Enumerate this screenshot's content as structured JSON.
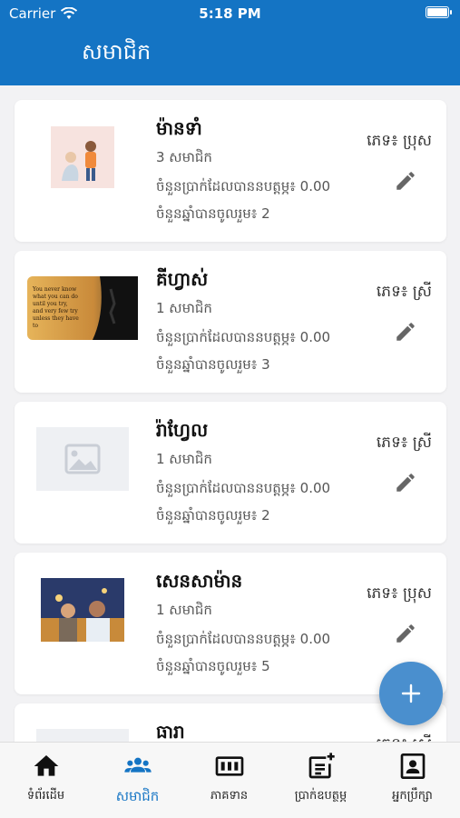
{
  "status_bar": {
    "carrier": "Carrier",
    "time": "5:18 PM"
  },
  "header": {
    "title": "សមាជិក"
  },
  "members": [
    {
      "name": "ម៉ានទាំ",
      "count": "3 សមាជិក",
      "amount": "ចំនួនប្រាក់ដែលបាននបត្តម្ភ៖ 0.00",
      "years": "ចំនួនឆ្នាំបានចូលរួម៖ 2",
      "gender": "ភេទ៖ ប្រុស"
    },
    {
      "name": "គីហ្វាស់",
      "count": "1 សមាជិក",
      "amount": "ចំនួនប្រាក់ដែលបាននបត្តម្ភ៖ 0.00",
      "years": "ចំនួនឆ្នាំបានចូលរួម៖ 3",
      "gender": "ភេទ៖ ស្រី"
    },
    {
      "name": "រ៉ាហ្វែល",
      "count": "1 សមាជិក",
      "amount": "ចំនួនប្រាក់ដែលបាននបត្តម្ភ៖ 0.00",
      "years": "ចំនួនឆ្នាំបានចូលរួម៖ 2",
      "gender": "ភេទ៖ ស្រី"
    },
    {
      "name": "សេនសាម៉ាន",
      "count": "1 សមាជិក",
      "amount": "ចំនួនប្រាក់ដែលបាននបត្តម្ភ៖ 0.00",
      "years": "ចំនួនឆ្នាំបានចូលរួម៖ 5",
      "gender": "ភេទ៖ ប្រុស"
    },
    {
      "name": "ធារា",
      "gender": "ភេទ៖ ស្រី"
    }
  ],
  "thumb_quote": "You never know what you can do until you try, and very few try unless they have to",
  "tabs": [
    {
      "label": "ទំព័រដើម",
      "icon": "home-icon"
    },
    {
      "label": "សមាជិក",
      "icon": "members-icon"
    },
    {
      "label": "ភាគទាន",
      "icon": "shares-icon"
    },
    {
      "label": "ប្រាក់ឧបត្ថម្ភ",
      "icon": "add-note-icon"
    },
    {
      "label": "អ្នកប្រឹក្សា",
      "icon": "advisor-icon"
    }
  ],
  "colors": {
    "primary": "#1474c4",
    "fab": "#4a8fce"
  }
}
